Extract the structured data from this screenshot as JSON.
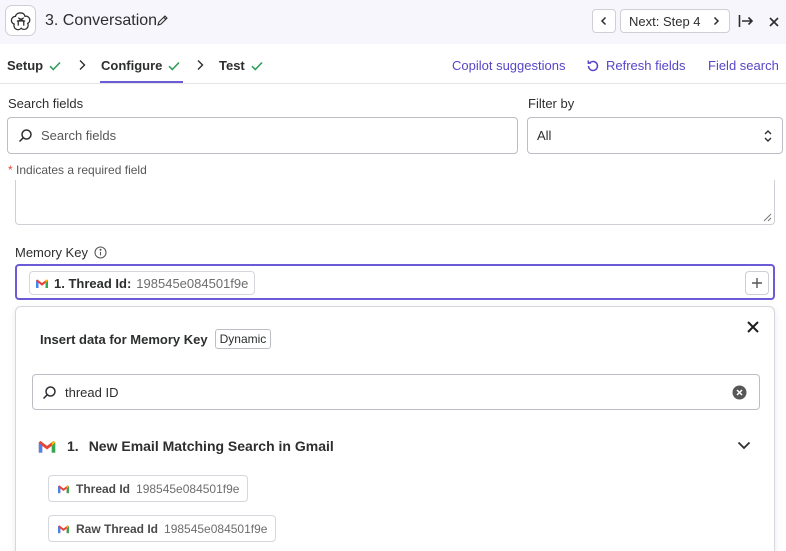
{
  "header": {
    "step_title": "3. Conversation",
    "next_label": "Next: Step 4"
  },
  "tabs": [
    {
      "label": "Setup",
      "complete": true
    },
    {
      "label": "Configure",
      "complete": true,
      "active": true
    },
    {
      "label": "Test",
      "complete": true
    }
  ],
  "links": {
    "copilot": "Copilot suggestions",
    "refresh": "Refresh fields",
    "field_search": "Field search"
  },
  "search": {
    "label": "Search fields",
    "placeholder": "Search fields",
    "value": ""
  },
  "filter": {
    "label": "Filter by",
    "value": "All"
  },
  "required_note": {
    "star": "*",
    "text": " Indicates a required field"
  },
  "memory_key": {
    "label": "Memory Key",
    "pill_key": "1. Thread Id:",
    "pill_value": "198545e084501f9e"
  },
  "dropdown": {
    "title": "Insert data for Memory Key",
    "badge": "Dynamic",
    "search_value": "thread ID",
    "group_label": "1.",
    "group_title": "New Email Matching Search in Gmail",
    "items": [
      {
        "key": "Thread Id",
        "value": "198545e084501f9e"
      },
      {
        "key": "Raw Thread Id",
        "value": "198545e084501f9e"
      }
    ]
  },
  "colors": {
    "accent": "#6b5bd6",
    "link": "#5746c7",
    "check": "#2f9e5a",
    "required": "#d94e3a"
  }
}
